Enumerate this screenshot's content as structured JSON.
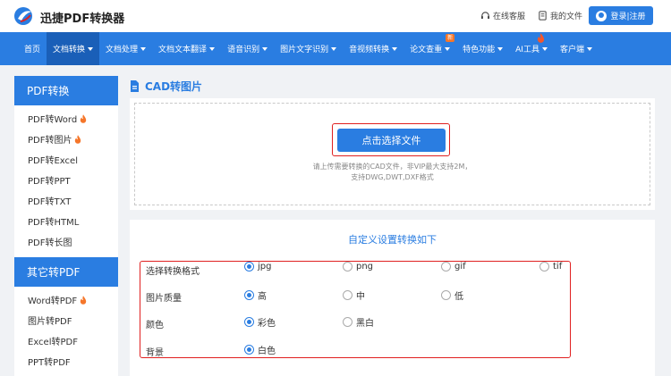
{
  "header": {
    "brand": "迅捷PDF转换器",
    "service_label": "在线客服",
    "files_label": "我的文件",
    "login_label": "登录|注册"
  },
  "nav": {
    "items": [
      {
        "label": "首页"
      },
      {
        "label": "文档转换"
      },
      {
        "label": "文档处理"
      },
      {
        "label": "文档文本翻译"
      },
      {
        "label": "语音识别"
      },
      {
        "label": "图片文字识别"
      },
      {
        "label": "音视频转换"
      },
      {
        "label": "论文查重",
        "badge": "新"
      },
      {
        "label": "特色功能"
      },
      {
        "label": "AI工具"
      },
      {
        "label": "客户端"
      }
    ]
  },
  "sidebar": {
    "group1_title": "PDF转换",
    "group1_items": [
      "PDF转Word",
      "PDF转图片",
      "PDF转Excel",
      "PDF转PPT",
      "PDF转TXT",
      "PDF转HTML",
      "PDF转长图"
    ],
    "group2_title": "其它转PDF",
    "group2_items": [
      "Word转PDF",
      "图片转PDF",
      "Excel转PDF",
      "PPT转PDF"
    ]
  },
  "main": {
    "section_title": "CAD转图片",
    "select_button": "点击选择文件",
    "hint_line1": "请上传需要转换的CAD文件，非VIP最大支持2M，",
    "hint_line2": "支持DWG,DWT,DXF格式"
  },
  "settings": {
    "title": "自定义设置转换如下",
    "rows": [
      {
        "label": "选择转换格式",
        "options": [
          "jpg",
          "png",
          "gif",
          "tif"
        ],
        "selected": "jpg"
      },
      {
        "label": "图片质量",
        "options": [
          "高",
          "中",
          "低"
        ],
        "selected": "高"
      },
      {
        "label": "颜色",
        "options": [
          "彩色",
          "黑白"
        ],
        "selected": "彩色"
      },
      {
        "label": "背景",
        "options": [
          "白色"
        ],
        "selected": "白色"
      }
    ]
  },
  "colors": {
    "accent": "#2a7de1",
    "nav_active": "#1a5fb8",
    "highlight_border": "#e02020",
    "hot_icon": "#f5762a"
  }
}
